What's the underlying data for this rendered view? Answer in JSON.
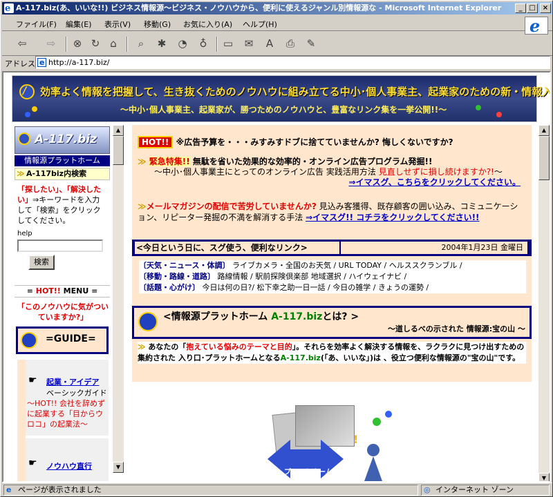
{
  "window": {
    "title": "A-117.biz(あ、いいな!!) ビジネス情報源～ビジネス・ノウハウから、便利に使えるジャンル別情報源な - Microsoft Internet Explorer",
    "minimize": "_",
    "maximize": "□",
    "close": "×"
  },
  "menu": [
    "ファイル(F)",
    "編集(E)",
    "表示(V)",
    "移動(G)",
    "お気に入り(A)",
    "ヘルプ(H)"
  ],
  "address": {
    "label": "アドレス",
    "url": "http://a-117.biz/"
  },
  "banner": {
    "line1": "効率よく情報を把握して、生き抜くためのノウハウに組み立てる中小･個人事業主、起業家のための新・情報入手ガイド",
    "line2": "～中小･個人事業主、起業家が、勝つためのノウハウと、豊富なリンク集を一挙公開!!～"
  },
  "sidebar": {
    "logo": "A-117.biz",
    "platform": "情報源プラットホーム",
    "search_title": "A-117biz内検索",
    "search_desc_red": "「探したい」、「解決したい」",
    "search_desc": "⇒キーワードを入力して「検索」をクリックしてください。",
    "help": "help",
    "search_button": "検索",
    "menu_label_prefix": "= ",
    "menu_hot": "HOT!!",
    "menu_label_suffix": " MENU =",
    "notice": "「このノウハウに気がついていますか?」",
    "guide": "=GUIDE=",
    "item1_title": "起業・アイデア",
    "item1_sub": "ベーシックガイド",
    "item1_hot": "～HOT!! 会社を辞めずに起業する「目からウロコ」の起業法～",
    "item2_title": "ノウハウ直行"
  },
  "main": {
    "hot_badge": "HOT!!",
    "headline": "※広告予算を・・・みすみすドブに捨てていませんか? 悔しくないですか?",
    "block1_title_red": "緊急特集!!",
    "block1_title": " 無駄を省いた効果的な効率的・オンライン広告プログラム発掘!!",
    "block1_sub": "～中小･個人事業主にとってのオンライン広告 実践活用方法",
    "block1_sub_red": "見直しせずに損し続けますか?!",
    "block1_sub_end": "～",
    "block1_link": "⇒イマスグ、こちらをクリックしてください。",
    "block2_title": "メールマガジンの配信で苦労していませんか?",
    "block2_body": "見込み客獲得、既存顧客の囲い込み、コミュニケーション、リピーター発掘の不満を解消する手法 ",
    "block2_link": "⇒イマスグ!! コチラをクリックしてください!!",
    "today_bar": "<今日という日に、スグ使う、便利なリンク>",
    "date": "2004年1月23日 金曜日",
    "links": [
      {
        "cat": "〔天気・ニュース・体調〕",
        "items": "ライブカメラ・全国のお天気 / URL TODAY / ヘルススクランブル /"
      },
      {
        "cat": "〔移動・路線・道路〕",
        "items": "路線情報 / 駅前探険倶楽部 地域選択 / ハイウェイナビ /"
      },
      {
        "cat": "〔話題・心がけ〕",
        "items": "今日は何の日?/ 松下幸之助一日一話 / 今日の雑学 / きょうの運勢 /"
      }
    ],
    "platform_title_a": "<情報源プラットホーム ",
    "platform_title_b": "A-117.biz",
    "platform_title_c": "とは? >",
    "platform_sub": "～道しるべの示された 情報源:宝の山 ～",
    "intro_a": "あなたの「",
    "intro_red": "抱えている悩みのテーマと目的",
    "intro_b": "」。それらを効率よく解決する情報を、ラクラクに見つけ出すための集約された 入り口･プラットホームとなる",
    "intro_green": "A-117.biz",
    "intro_c": "(「あ、いいな」)は 、役立つ便利な情報源の\"宝の山\"です。",
    "image_label": "プラットホーム"
  },
  "status": {
    "left": "ページが表示されました",
    "right": "インターネット ゾーン"
  }
}
